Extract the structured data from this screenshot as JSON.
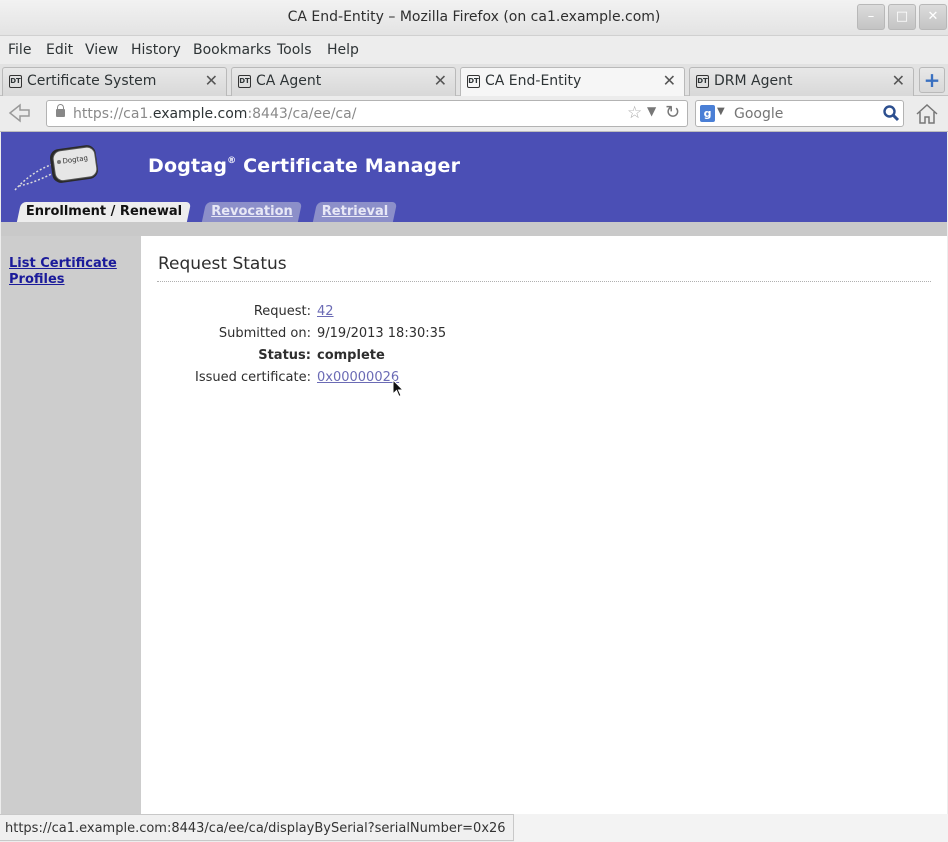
{
  "window": {
    "title": "CA End-Entity – Mozilla Firefox (on ca1.example.com)"
  },
  "menu": [
    "File",
    "Edit",
    "View",
    "History",
    "Bookmarks",
    "Tools",
    "Help"
  ],
  "tabs": [
    {
      "label": "Certificate System",
      "active": false
    },
    {
      "label": "CA Agent",
      "active": false
    },
    {
      "label": "CA End-Entity",
      "active": true
    },
    {
      "label": "DRM Agent",
      "active": false
    }
  ],
  "nav": {
    "url_prefix": "https://ca1.",
    "url_domain": "example.com",
    "url_suffix": ":8443/ca/ee/ca/",
    "search_placeholder": "Google"
  },
  "app": {
    "name": "Dogtag",
    "reg": "®",
    "name_rest": " Certificate Manager",
    "logo_text": "Dogtag",
    "page_tabs": [
      {
        "label": "Enrollment / Renewal",
        "active": true
      },
      {
        "label": "Revocation",
        "active": false
      },
      {
        "label": "Retrieval",
        "active": false
      }
    ]
  },
  "sidebar": {
    "link": "List Certificate Profiles"
  },
  "request_status": {
    "title": "Request Status",
    "request_label": "Request:",
    "request_value": "42",
    "submitted_label": "Submitted on:",
    "submitted_value": "9/19/2013 18:30:35",
    "status_label": "Status:",
    "status_value": "complete",
    "issued_label": "Issued certificate:",
    "issued_value": "0x00000026"
  },
  "statusbar": {
    "text": "https://ca1.example.com:8443/ca/ee/ca/displayBySerial?serialNumber=0x26"
  },
  "colors": {
    "banner": "#4b4fb5",
    "link": "#6b6bb5"
  }
}
